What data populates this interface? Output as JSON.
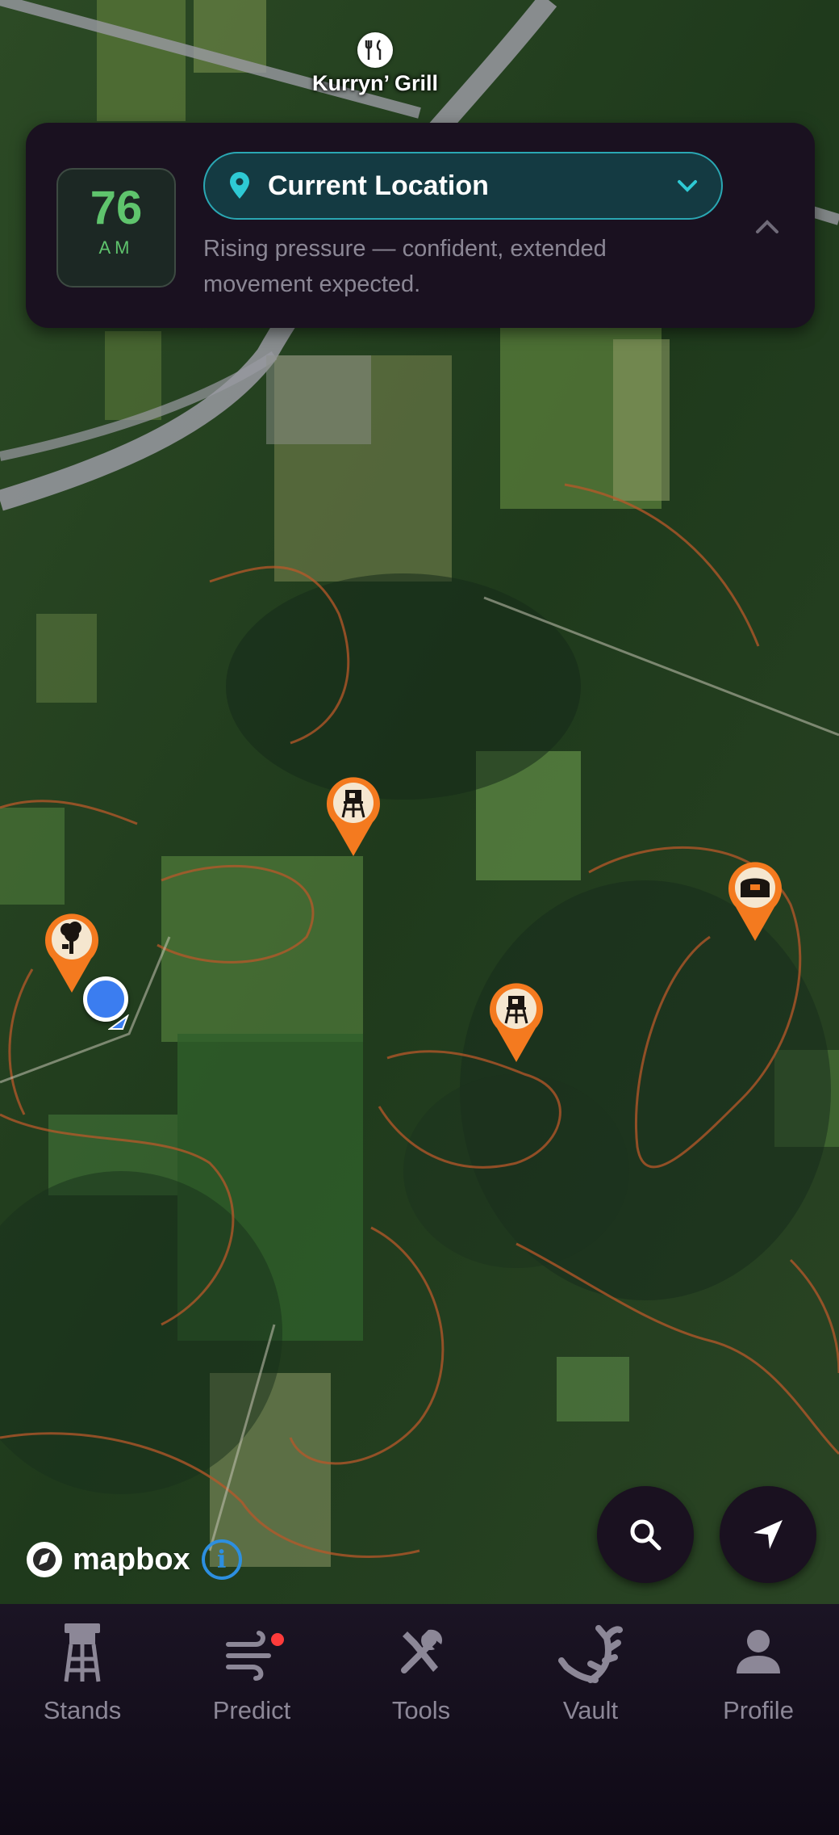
{
  "map": {
    "poi_label": "Kurryn’ Grill",
    "attribution": "mapbox",
    "info_glyph": "i"
  },
  "forecast_card": {
    "score": "76",
    "period": "AM",
    "location_label": "Current Location",
    "description": "Rising pressure — confident, extended movement expected.",
    "accent_color": "#5fc46d",
    "location_pill_border": "#2aa7b3"
  },
  "pins": [
    {
      "icon": "stand-tower-icon"
    },
    {
      "icon": "tree-stand-icon"
    },
    {
      "icon": "stand-tower-icon"
    },
    {
      "icon": "ground-blind-icon"
    }
  ],
  "pin_color": "#f47a1f",
  "buttons": {
    "search_icon": "search-icon",
    "locate_icon": "navigation-arrow-icon"
  },
  "tabs": [
    {
      "label": "Stands",
      "icon": "stand-icon"
    },
    {
      "label": "Predict",
      "icon": "wind-icon",
      "badge": true
    },
    {
      "label": "Tools",
      "icon": "tools-icon"
    },
    {
      "label": "Vault",
      "icon": "antler-icon"
    },
    {
      "label": "Profile",
      "icon": "person-icon"
    }
  ]
}
